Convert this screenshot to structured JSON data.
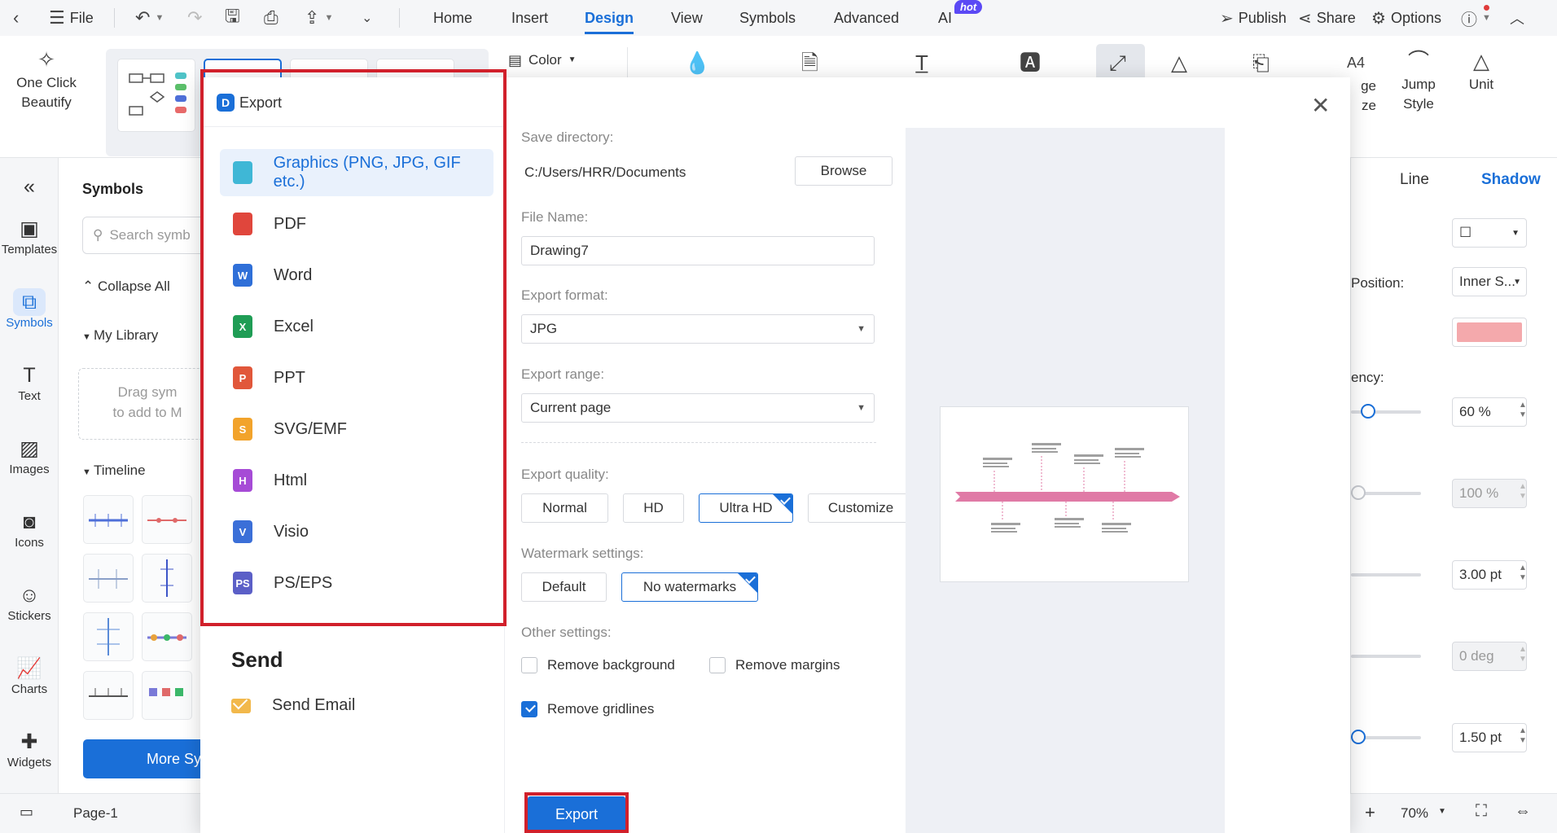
{
  "menubar": {
    "file_label": "File",
    "tabs": [
      "Home",
      "Insert",
      "Design",
      "View",
      "Symbols",
      "Advanced",
      "AI"
    ],
    "hot_badge": "hot",
    "publish": "Publish",
    "share": "Share",
    "options": "Options"
  },
  "ribbon": {
    "one_click_line1": "One Click",
    "one_click_line2": "Beautify",
    "color_label": "Color",
    "jump_style_line1": "Jump",
    "jump_style_line2": "Style",
    "unit_label": "Unit",
    "page_size_partial1": "ge",
    "page_size_partial2": "ze"
  },
  "rail": {
    "items": [
      "Templates",
      "Symbols",
      "Text",
      "Images",
      "Icons",
      "Stickers",
      "Charts",
      "Widgets"
    ]
  },
  "symbols_panel": {
    "title": "Symbols",
    "search_placeholder": "Search symb",
    "collapse_all": "Collapse All",
    "my_library": "My Library",
    "drag_hint_line1": "Drag sym",
    "drag_hint_line2": "to add to M",
    "timeline": "Timeline",
    "more_symbols": "More Sy"
  },
  "props_panel": {
    "tabs": [
      "Line",
      "Shadow"
    ],
    "position_label": "Position:",
    "position_value": "Inner S...",
    "transparency_label": "ency:",
    "transparency_value": "60 %",
    "value2": "100 %",
    "value3": "3.00 pt",
    "value4": "0 deg",
    "value5": "1.50 pt",
    "shadow_color": "#f4a9ac"
  },
  "statusbar": {
    "page_tab": "Page-1",
    "zoom": "70%"
  },
  "dialog": {
    "title": "Export",
    "formats": [
      {
        "label": "Graphics (PNG, JPG, GIF etc.)",
        "icon": "image-file-icon",
        "color": "#3fb7d6",
        "glyph": ""
      },
      {
        "label": "PDF",
        "icon": "pdf-file-icon",
        "color": "#e0463c",
        "glyph": ""
      },
      {
        "label": "Word",
        "icon": "word-file-icon",
        "color": "#2f6fd8",
        "glyph": "W"
      },
      {
        "label": "Excel",
        "icon": "excel-file-icon",
        "color": "#1f9d55",
        "glyph": "X"
      },
      {
        "label": "PPT",
        "icon": "ppt-file-icon",
        "color": "#e1573a",
        "glyph": "P"
      },
      {
        "label": "SVG/EMF",
        "icon": "svg-file-icon",
        "color": "#f2a32b",
        "glyph": "S"
      },
      {
        "label": "Html",
        "icon": "html-file-icon",
        "color": "#a64bd6",
        "glyph": "H"
      },
      {
        "label": "Visio",
        "icon": "visio-file-icon",
        "color": "#3b6fd8",
        "glyph": "V"
      },
      {
        "label": "PS/EPS",
        "icon": "ps-file-icon",
        "color": "#5b5fc7",
        "glyph": "PS"
      }
    ],
    "send_title": "Send",
    "send_email": "Send Email",
    "save_directory_label": "Save directory:",
    "save_directory_value": "C:/Users/HRR/Documents",
    "browse_label": "Browse",
    "file_name_label": "File Name:",
    "file_name_value": "Drawing7",
    "export_format_label": "Export format:",
    "export_format_value": "JPG",
    "export_range_label": "Export range:",
    "export_range_value": "Current page",
    "export_quality_label": "Export quality:",
    "quality_options": [
      "Normal",
      "HD",
      "Ultra HD",
      "Customize"
    ],
    "quality_selected": "Ultra HD",
    "watermark_label": "Watermark settings:",
    "watermark_options": [
      "Default",
      "No watermarks"
    ],
    "watermark_selected": "No watermarks",
    "other_settings_label": "Other settings:",
    "remove_background": "Remove background",
    "remove_margins": "Remove margins",
    "remove_gridlines": "Remove gridlines",
    "remove_gridlines_checked": true,
    "export_button": "Export",
    "highlight_color": "#d1202b",
    "accent_color": "#1a6fd8"
  }
}
